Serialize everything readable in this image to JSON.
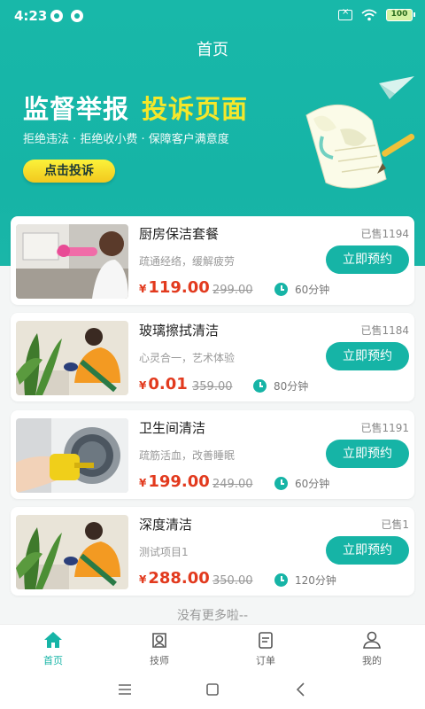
{
  "status": {
    "time": "4:23",
    "battery": "100"
  },
  "header": {
    "title": "首页"
  },
  "banner": {
    "title_main": "监督举报",
    "title_accent": "投诉页面",
    "subtitle": "拒绝违法 · 拒绝收小费 · 保障客户满意度",
    "button": "点击投诉"
  },
  "services": [
    {
      "name": "厨房保洁套餐",
      "sold": "已售1194",
      "desc": "疏通经络，缓解疲劳",
      "currency": "¥",
      "price": "119.00",
      "original": "299.00",
      "duration": "60分钟",
      "button": "立即预约"
    },
    {
      "name": "玻璃擦拭清洁",
      "sold": "已售1184",
      "desc": "心灵合一，艺术体验",
      "currency": "¥",
      "price": "0.01",
      "original": "359.00",
      "duration": "80分钟",
      "button": "立即预约"
    },
    {
      "name": "卫生间清洁",
      "sold": "已售1191",
      "desc": "疏筋活血，改善睡眠",
      "currency": "¥",
      "price": "199.00",
      "original": "249.00",
      "duration": "60分钟",
      "button": "立即预约"
    },
    {
      "name": "深度清洁",
      "sold": "已售1",
      "desc": "测试项目1",
      "currency": "¥",
      "price": "288.00",
      "original": "350.00",
      "duration": "120分钟",
      "button": "立即预约"
    }
  ],
  "footer_text": "没有更多啦--",
  "tabbar": [
    {
      "label": "首页",
      "icon": "home-icon",
      "active": true
    },
    {
      "label": "技师",
      "icon": "technician-icon",
      "active": false
    },
    {
      "label": "订单",
      "icon": "order-icon",
      "active": false
    },
    {
      "label": "我的",
      "icon": "profile-icon",
      "active": false
    }
  ],
  "colors": {
    "primary": "#16b4a6",
    "price": "#e23a1e",
    "banner_accent": "#f5e72a"
  }
}
